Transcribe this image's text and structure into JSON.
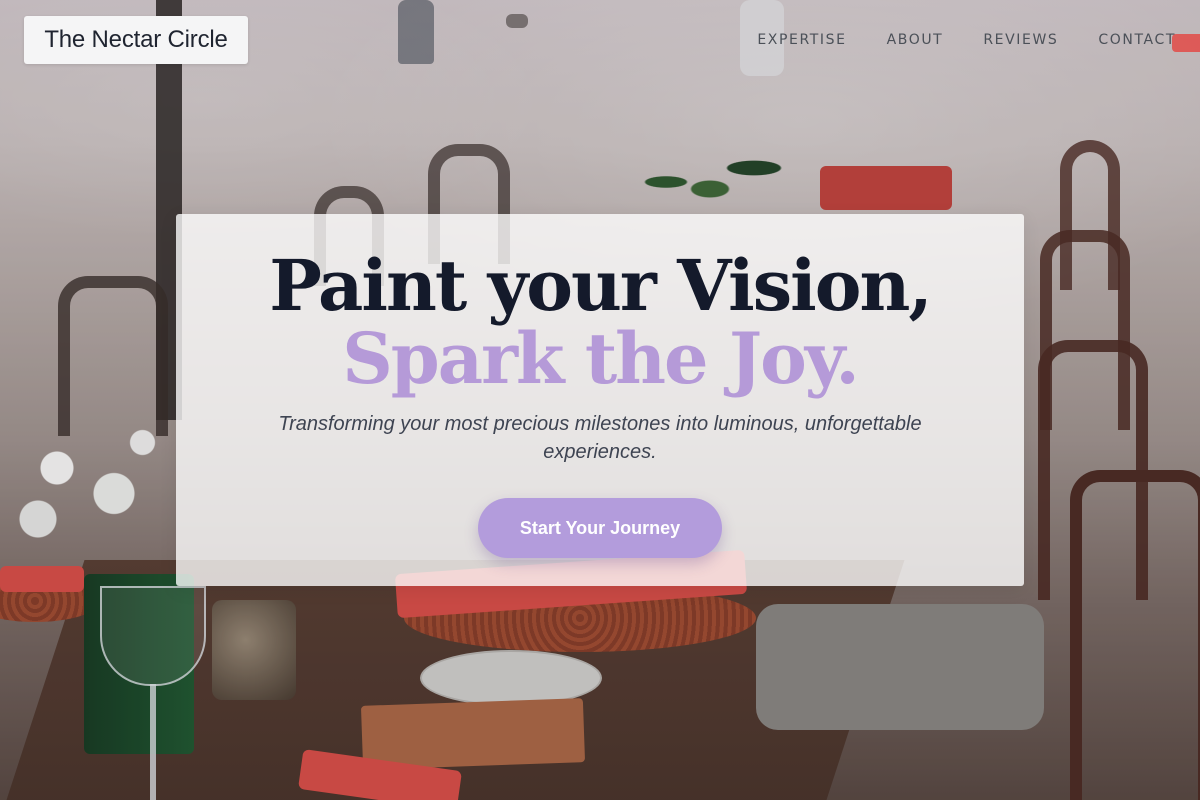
{
  "brand": {
    "logo_text": "The Nectar Circle"
  },
  "nav": {
    "items": [
      {
        "label": "EXPERTISE"
      },
      {
        "label": "ABOUT"
      },
      {
        "label": "REVIEWS"
      },
      {
        "label": "CONTACT"
      }
    ]
  },
  "hero": {
    "headline_line1": "Paint your Vision,",
    "headline_line2": "Spark the Joy.",
    "subtitle": "Transforming your most precious milestones into luminous, unforgettable experiences.",
    "cta_label": "Start Your Journey"
  },
  "colors": {
    "headline_dark": "#141a2b",
    "headline_accent": "#b59ad8",
    "cta_background": "#b39cdc",
    "nav_text": "#4b5058"
  },
  "background_image": {
    "subject": "outdoor dining table set on beach"
  }
}
